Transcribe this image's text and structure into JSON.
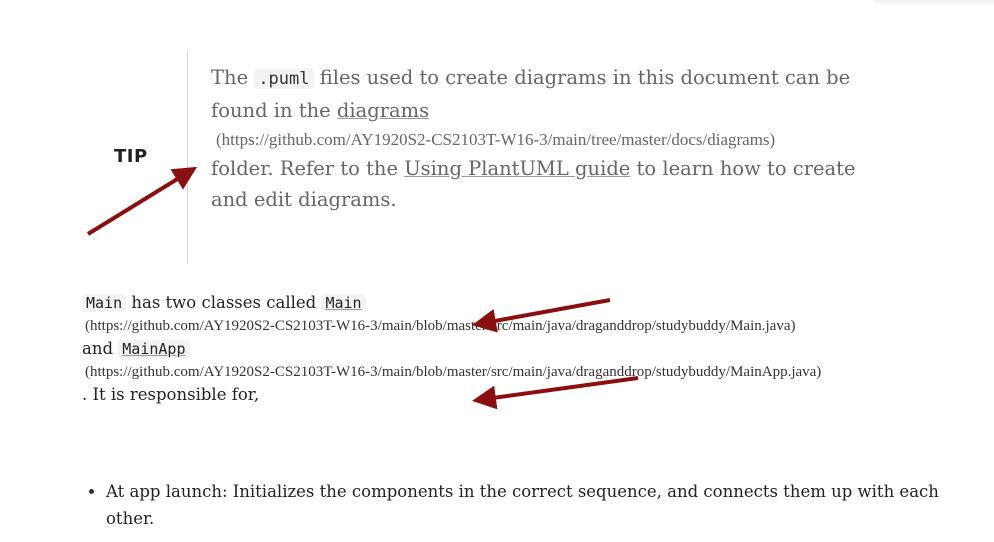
{
  "tip": {
    "label": "TIP",
    "line1_before": "The ",
    "code": ".puml",
    "line1_after": " files used to create diagrams in this document can be found in the ",
    "diagrams_link": "diagrams",
    "diagrams_url": "(https://github.com/AY1920S2-CS2103T-W16-3/main/tree/master/docs/diagrams)",
    "after_url": "folder. Refer to the ",
    "guide_link": "Using PlantUML guide",
    "ending": " to learn how to create and edit diagrams."
  },
  "main_para": {
    "code_main": "Main",
    "has_two": " has two classes called ",
    "code_main_link": "Main",
    "main_url": "(https://github.com/AY1920S2-CS2103T-W16-3/main/blob/master/src/main/java/draganddrop/studybuddy/Main.java)",
    "and_text": "and ",
    "code_mainapp": "MainApp",
    "mainapp_url": "(https://github.com/AY1920S2-CS2103T-W16-3/main/blob/master/src/main/java/draganddrop/studybuddy/MainApp.java)",
    "responsible": ". It is responsible for,"
  },
  "bullets": [
    "At app launch: Initializes the components in the correct sequence, and connects them up with each other."
  ],
  "colors": {
    "arrow": "#8b0f0f",
    "muted_text": "#666666",
    "body_text": "#222222"
  }
}
